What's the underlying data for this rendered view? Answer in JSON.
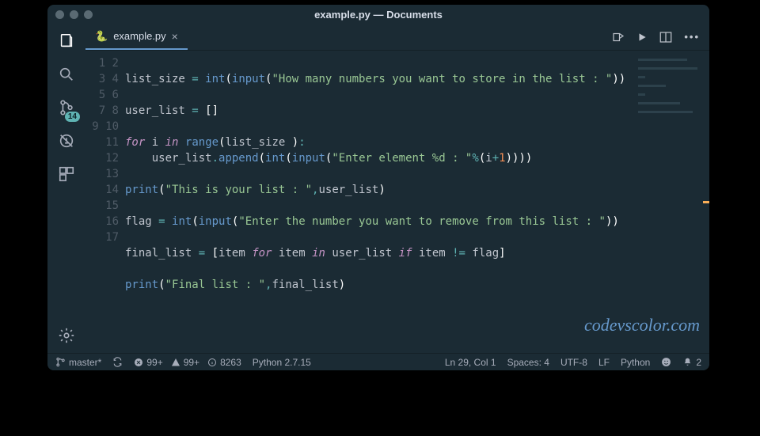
{
  "title": "example.py — Documents",
  "tab": {
    "label": "example.py"
  },
  "activity": {
    "badge": "14"
  },
  "watermark": "codevscolor.com",
  "code": {
    "lines": [
      "1",
      "2",
      "3",
      "4",
      "5",
      "6",
      "7",
      "8",
      "9",
      "10",
      "11",
      "12",
      "13",
      "14",
      "15",
      "16",
      "17"
    ],
    "t": {
      "list_size": "list_size",
      "eq": " = ",
      "int": "int",
      "input": "input",
      "lp": "(",
      "rp": ")",
      "lb": "[",
      "rb": "]",
      "comma": ",",
      "colon": ":",
      "s_prompt1": "\"How many numbers you want to store in the list : \"",
      "user_list": "user_list",
      "empty_list": "[]",
      "for": "for",
      "i": "i",
      "in": "in",
      "range": "range",
      "space": " ",
      "append": "append",
      "s_prompt2": "\"Enter element %d : \"",
      "pct": "%",
      "plus": "+",
      "one": "1",
      "print": "print",
      "s_this": "\"This is your list : \"",
      "flag": "flag",
      "s_prompt3": "\"Enter the number you want to remove from this list : \"",
      "final_list": "final_list",
      "item": "item",
      "if": "if",
      "ne": " != ",
      "s_final": "\"Final list : \"",
      "dot": "."
    }
  },
  "status": {
    "branch": "master*",
    "errors": "99+",
    "warnings": "99+",
    "info_count": "8263",
    "python_version": "Python 2.7.15",
    "cursor": "Ln 29, Col 1",
    "spaces": "Spaces: 4",
    "encoding": "UTF-8",
    "eol": "LF",
    "lang": "Python",
    "bell": "2"
  }
}
